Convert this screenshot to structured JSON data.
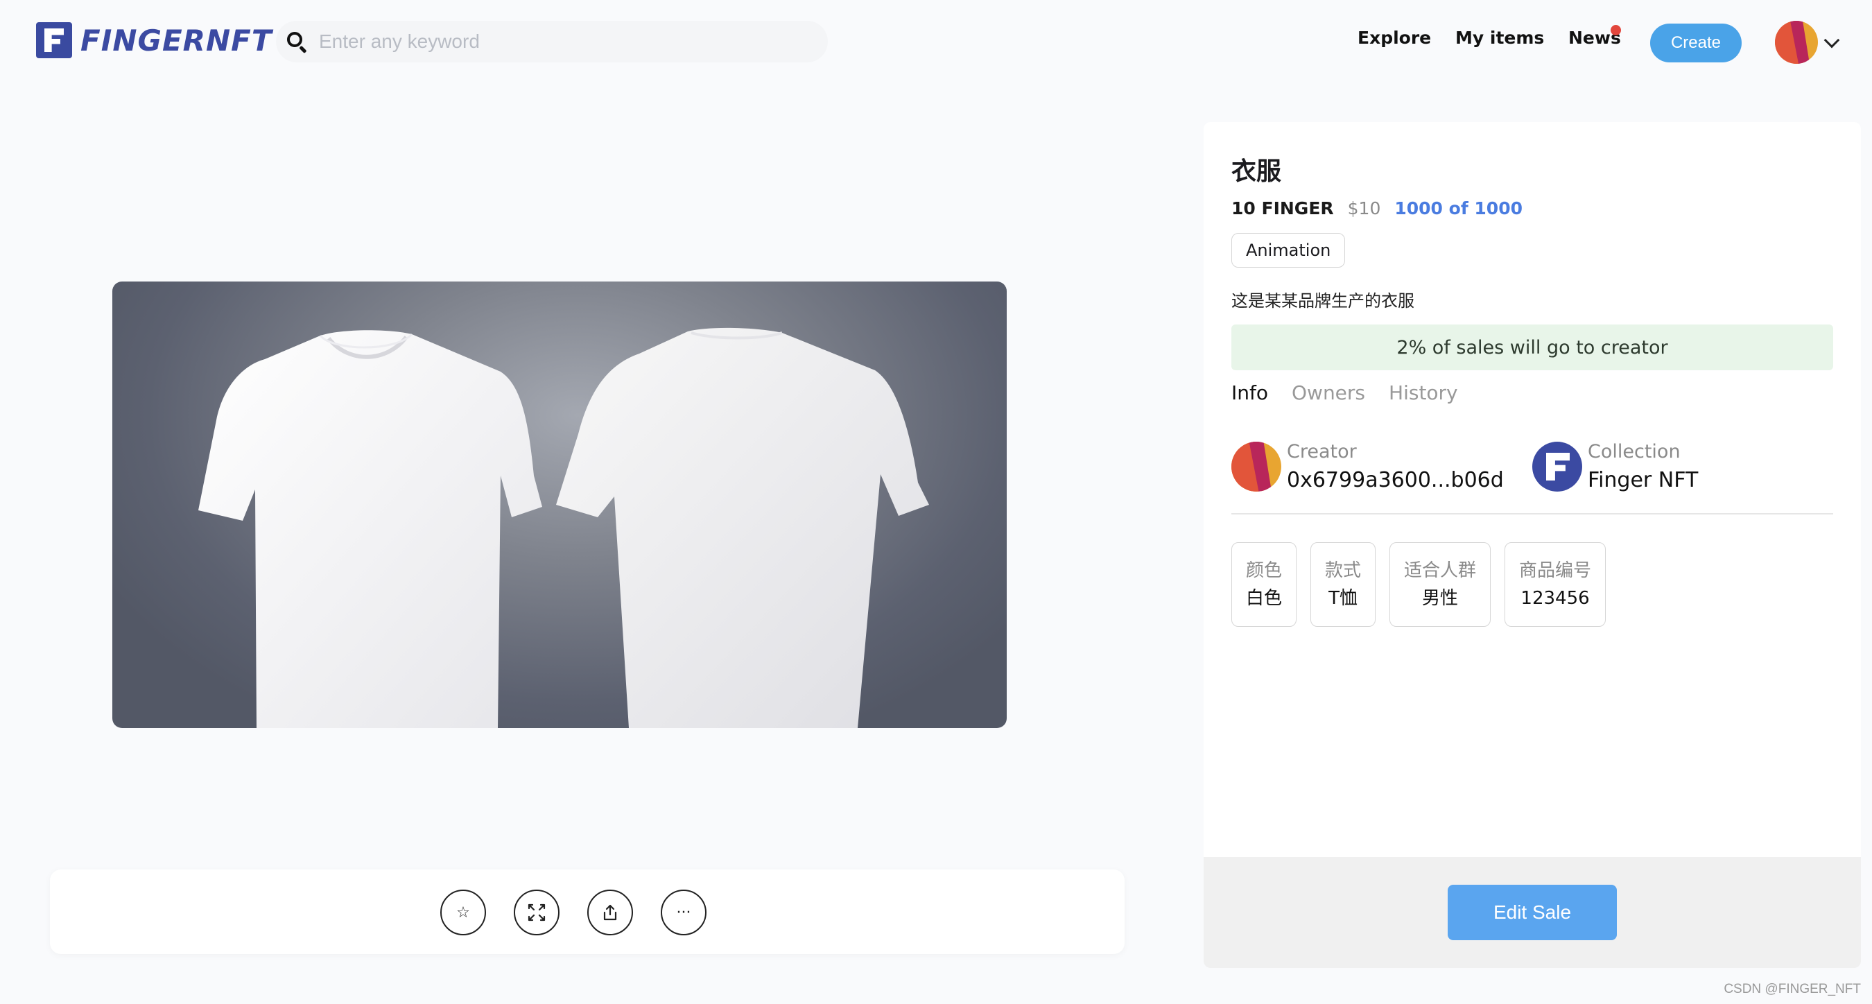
{
  "brand": {
    "name": "FINGERNFT"
  },
  "search": {
    "placeholder": "Enter any keyword"
  },
  "nav": {
    "explore": "Explore",
    "my_items": "My items",
    "news": "News",
    "create": "Create"
  },
  "colors": {
    "accent": "#4aa3e8",
    "brand": "#3b4aa2",
    "royalty_bg": "#e8f5e9",
    "quantity": "#4a7ce0",
    "notification": "#e2463c"
  },
  "item": {
    "title": "衣服",
    "price": "10 FINGER",
    "price_usd": "$10",
    "quantity": "1000 of 1000",
    "tag": "Animation",
    "description": "这是某某品牌生产的衣服",
    "royalty": "2% of sales will go to creator"
  },
  "tabs": [
    {
      "label": "Info"
    },
    {
      "label": "Owners"
    },
    {
      "label": "History"
    }
  ],
  "creator": {
    "label": "Creator",
    "value": "0x6799a3600...b06d"
  },
  "collection": {
    "label": "Collection",
    "value": "Finger NFT"
  },
  "properties": [
    {
      "key": "颜色",
      "value": "白色"
    },
    {
      "key": "款式",
      "value": "T恤"
    },
    {
      "key": "适合人群",
      "value": "男性"
    },
    {
      "key": "商品编号",
      "value": "123456"
    }
  ],
  "actions": {
    "like_icon": "star-icon",
    "fullscreen_icon": "expand-icon",
    "share_icon": "share-icon",
    "more": "···"
  },
  "edit_sale": "Edit Sale",
  "watermark": "CSDN @FINGER_NFT"
}
